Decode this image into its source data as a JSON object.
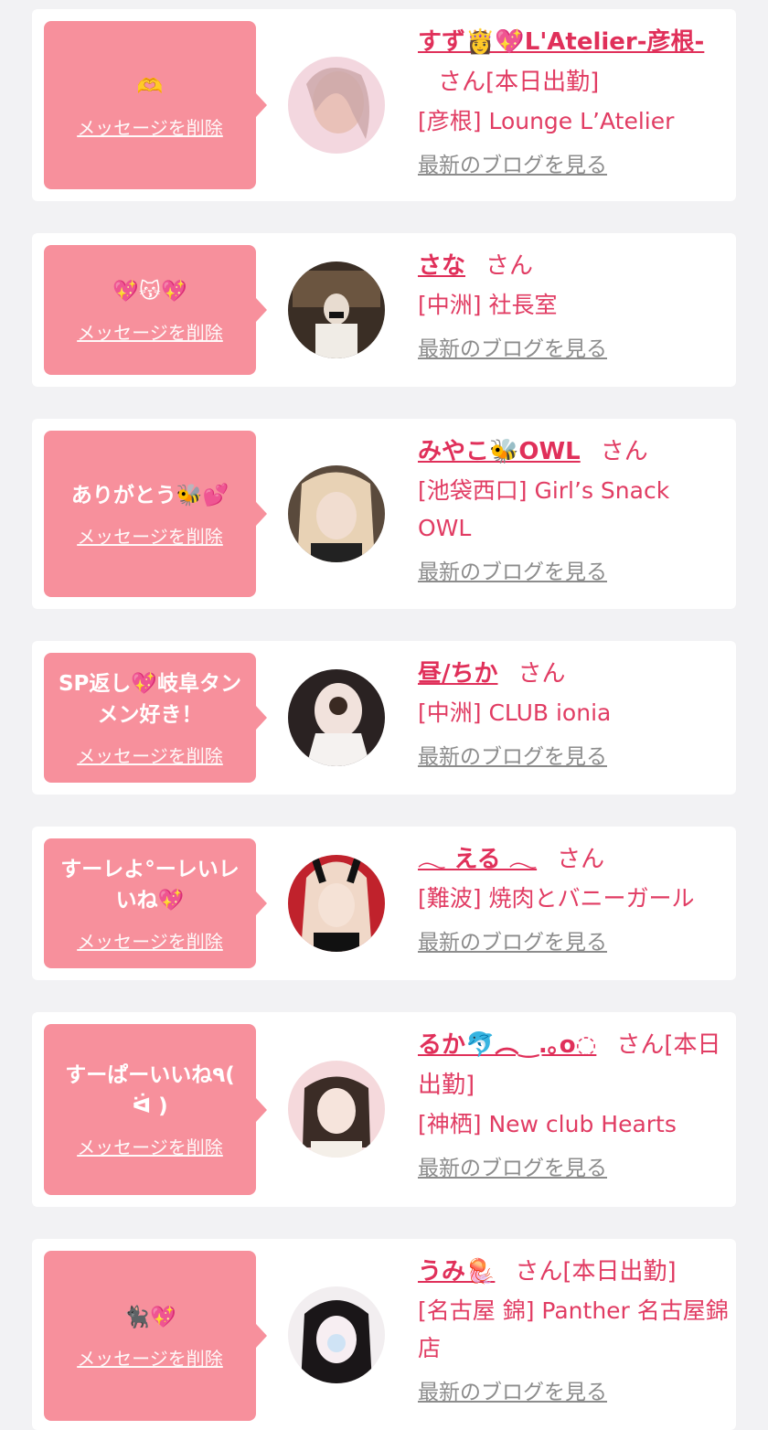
{
  "cards": [
    {
      "message": "🫶",
      "delete_label": "メッセージを削除",
      "name": "すず👸💖L'Atelier-彦根-",
      "san": "さん",
      "status": "[本日出勤]",
      "shop": "[彦根] Lounge L’Atelier",
      "blog_label": "最新のブログを見る",
      "avatar_colors": [
        "#f3d7df",
        "#caa6a8"
      ]
    },
    {
      "message": "💖😽💖",
      "delete_label": "メッセージを削除",
      "name": "さな",
      "san": "さん",
      "status": "",
      "shop": "[中洲] 社長室",
      "blog_label": "最新のブログを見る",
      "avatar_colors": [
        "#3a2e25",
        "#8c7458"
      ]
    },
    {
      "message": "ありがとう🐝💕",
      "delete_label": "メッセージを削除",
      "name": "みやこ🐝OWL",
      "san": "さん",
      "status": "",
      "shop": "[池袋西口] Girl’s Snack OWL",
      "blog_label": "最新のブログを見る",
      "avatar_colors": [
        "#e8d2b5",
        "#5a4a3c"
      ]
    },
    {
      "message": "SP返し💖岐阜タンメン好き！",
      "delete_label": "メッセージを削除",
      "name": "昼/ちか",
      "san": "さん",
      "status": "",
      "shop": "[中洲] CLUB ionia",
      "blog_label": "最新のブログを見る",
      "avatar_colors": [
        "#f1e2dc",
        "#2a2222"
      ]
    },
    {
      "message": "すーレよ°ーレいレいね💖",
      "delete_label": "メッセージを削除",
      "name": "𓂃 える 𓂃",
      "san": "さん",
      "status": "",
      "shop": "[難波] 焼肉とバニーガール",
      "blog_label": "最新のブログを見る",
      "avatar_colors": [
        "#c0222c",
        "#f0d8c8"
      ]
    },
    {
      "message": "すーぱーいいね٩( ᐛ )",
      "delete_label": "メッセージを削除",
      "name": "るか🐬︵‿.｡o◌",
      "san": "さん",
      "status": "[本日出勤]",
      "shop": "[神栖] New club Hearts",
      "blog_label": "最新のブログを見る",
      "avatar_colors": [
        "#f5d9dc",
        "#3b2c26"
      ]
    },
    {
      "message": "🐈‍⬛💖",
      "delete_label": "メッセージを削除",
      "name": "うみ🪼",
      "san": "さん",
      "status": "[本日出勤]",
      "shop": "[名古屋 錦] Panther 名古屋錦店",
      "blog_label": "最新のブログを見る",
      "avatar_colors": [
        "#f2eef0",
        "#1a1618"
      ]
    }
  ]
}
